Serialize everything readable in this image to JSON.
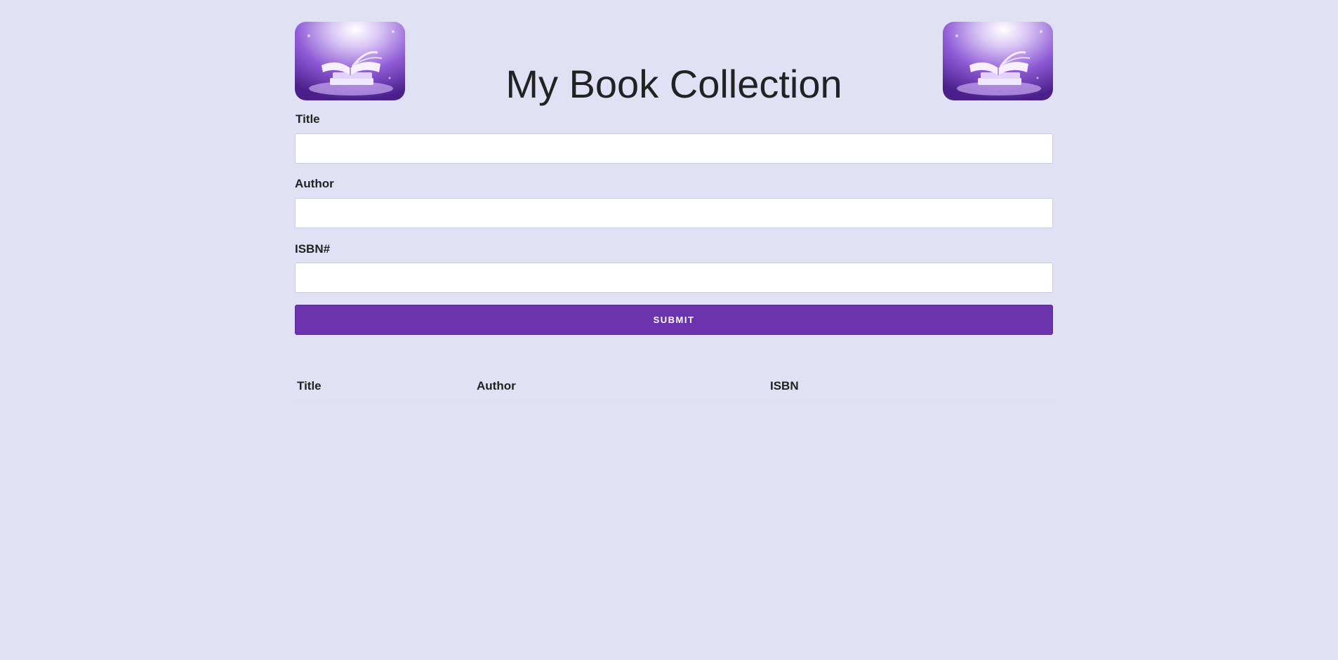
{
  "page": {
    "title": "My Book Collection",
    "background_color": "#e1e1f6",
    "accent_color": "#6c34ac"
  },
  "header": {
    "left_logo_icon": "open-book-icon",
    "right_logo_icon": "open-book-icon"
  },
  "form": {
    "title_label": "Title",
    "title_value": "",
    "author_label": "Author",
    "author_value": "",
    "isbn_label": "ISBN#",
    "isbn_value": "",
    "submit_label": "SUBMIT"
  },
  "table": {
    "headers": [
      "Title",
      "Author",
      "ISBN"
    ],
    "rows": []
  }
}
